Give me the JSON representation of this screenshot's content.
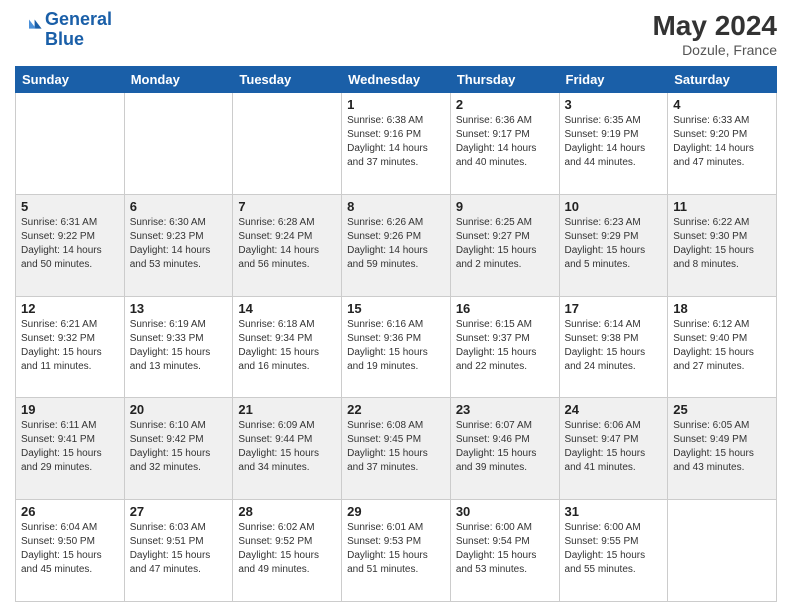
{
  "header": {
    "logo_line1": "General",
    "logo_line2": "Blue",
    "month_year": "May 2024",
    "location": "Dozule, France"
  },
  "days_of_week": [
    "Sunday",
    "Monday",
    "Tuesday",
    "Wednesday",
    "Thursday",
    "Friday",
    "Saturday"
  ],
  "weeks": [
    [
      {
        "day": "",
        "info": ""
      },
      {
        "day": "",
        "info": ""
      },
      {
        "day": "",
        "info": ""
      },
      {
        "day": "1",
        "info": "Sunrise: 6:38 AM\nSunset: 9:16 PM\nDaylight: 14 hours\nand 37 minutes."
      },
      {
        "day": "2",
        "info": "Sunrise: 6:36 AM\nSunset: 9:17 PM\nDaylight: 14 hours\nand 40 minutes."
      },
      {
        "day": "3",
        "info": "Sunrise: 6:35 AM\nSunset: 9:19 PM\nDaylight: 14 hours\nand 44 minutes."
      },
      {
        "day": "4",
        "info": "Sunrise: 6:33 AM\nSunset: 9:20 PM\nDaylight: 14 hours\nand 47 minutes."
      }
    ],
    [
      {
        "day": "5",
        "info": "Sunrise: 6:31 AM\nSunset: 9:22 PM\nDaylight: 14 hours\nand 50 minutes."
      },
      {
        "day": "6",
        "info": "Sunrise: 6:30 AM\nSunset: 9:23 PM\nDaylight: 14 hours\nand 53 minutes."
      },
      {
        "day": "7",
        "info": "Sunrise: 6:28 AM\nSunset: 9:24 PM\nDaylight: 14 hours\nand 56 minutes."
      },
      {
        "day": "8",
        "info": "Sunrise: 6:26 AM\nSunset: 9:26 PM\nDaylight: 14 hours\nand 59 minutes."
      },
      {
        "day": "9",
        "info": "Sunrise: 6:25 AM\nSunset: 9:27 PM\nDaylight: 15 hours\nand 2 minutes."
      },
      {
        "day": "10",
        "info": "Sunrise: 6:23 AM\nSunset: 9:29 PM\nDaylight: 15 hours\nand 5 minutes."
      },
      {
        "day": "11",
        "info": "Sunrise: 6:22 AM\nSunset: 9:30 PM\nDaylight: 15 hours\nand 8 minutes."
      }
    ],
    [
      {
        "day": "12",
        "info": "Sunrise: 6:21 AM\nSunset: 9:32 PM\nDaylight: 15 hours\nand 11 minutes."
      },
      {
        "day": "13",
        "info": "Sunrise: 6:19 AM\nSunset: 9:33 PM\nDaylight: 15 hours\nand 13 minutes."
      },
      {
        "day": "14",
        "info": "Sunrise: 6:18 AM\nSunset: 9:34 PM\nDaylight: 15 hours\nand 16 minutes."
      },
      {
        "day": "15",
        "info": "Sunrise: 6:16 AM\nSunset: 9:36 PM\nDaylight: 15 hours\nand 19 minutes."
      },
      {
        "day": "16",
        "info": "Sunrise: 6:15 AM\nSunset: 9:37 PM\nDaylight: 15 hours\nand 22 minutes."
      },
      {
        "day": "17",
        "info": "Sunrise: 6:14 AM\nSunset: 9:38 PM\nDaylight: 15 hours\nand 24 minutes."
      },
      {
        "day": "18",
        "info": "Sunrise: 6:12 AM\nSunset: 9:40 PM\nDaylight: 15 hours\nand 27 minutes."
      }
    ],
    [
      {
        "day": "19",
        "info": "Sunrise: 6:11 AM\nSunset: 9:41 PM\nDaylight: 15 hours\nand 29 minutes."
      },
      {
        "day": "20",
        "info": "Sunrise: 6:10 AM\nSunset: 9:42 PM\nDaylight: 15 hours\nand 32 minutes."
      },
      {
        "day": "21",
        "info": "Sunrise: 6:09 AM\nSunset: 9:44 PM\nDaylight: 15 hours\nand 34 minutes."
      },
      {
        "day": "22",
        "info": "Sunrise: 6:08 AM\nSunset: 9:45 PM\nDaylight: 15 hours\nand 37 minutes."
      },
      {
        "day": "23",
        "info": "Sunrise: 6:07 AM\nSunset: 9:46 PM\nDaylight: 15 hours\nand 39 minutes."
      },
      {
        "day": "24",
        "info": "Sunrise: 6:06 AM\nSunset: 9:47 PM\nDaylight: 15 hours\nand 41 minutes."
      },
      {
        "day": "25",
        "info": "Sunrise: 6:05 AM\nSunset: 9:49 PM\nDaylight: 15 hours\nand 43 minutes."
      }
    ],
    [
      {
        "day": "26",
        "info": "Sunrise: 6:04 AM\nSunset: 9:50 PM\nDaylight: 15 hours\nand 45 minutes."
      },
      {
        "day": "27",
        "info": "Sunrise: 6:03 AM\nSunset: 9:51 PM\nDaylight: 15 hours\nand 47 minutes."
      },
      {
        "day": "28",
        "info": "Sunrise: 6:02 AM\nSunset: 9:52 PM\nDaylight: 15 hours\nand 49 minutes."
      },
      {
        "day": "29",
        "info": "Sunrise: 6:01 AM\nSunset: 9:53 PM\nDaylight: 15 hours\nand 51 minutes."
      },
      {
        "day": "30",
        "info": "Sunrise: 6:00 AM\nSunset: 9:54 PM\nDaylight: 15 hours\nand 53 minutes."
      },
      {
        "day": "31",
        "info": "Sunrise: 6:00 AM\nSunset: 9:55 PM\nDaylight: 15 hours\nand 55 minutes."
      },
      {
        "day": "",
        "info": ""
      }
    ]
  ],
  "row_styles": [
    "odd",
    "even",
    "odd",
    "even",
    "odd"
  ]
}
